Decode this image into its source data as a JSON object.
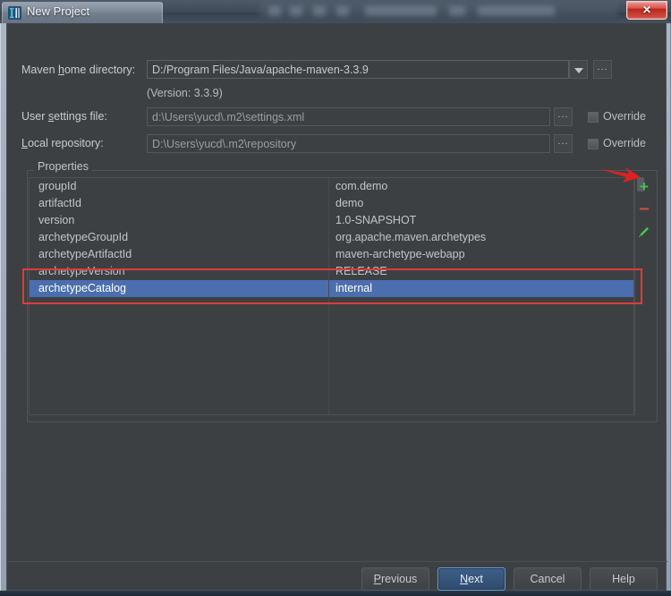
{
  "window": {
    "title": "New Project",
    "icon": "intellij-idea-icon",
    "close_label": "✕"
  },
  "form": {
    "maven_home": {
      "label_pre": "Maven ",
      "label_accel": "h",
      "label_post": "ome directory:",
      "label_full": "Maven home directory:",
      "value": "D:/Program Files/Java/apache-maven-3.3.9",
      "dropdown_icon": "chevron-down-icon",
      "browse_label": "..."
    },
    "version_note": "(Version: 3.3.9)",
    "user_settings": {
      "label_full": "User settings file:",
      "value": "d:\\Users\\yucd\\.m2\\settings.xml",
      "browse_label": "...",
      "override_label": "Override",
      "override_checked": false
    },
    "local_repository": {
      "label_full": "Local repository:",
      "value": "D:\\Users\\yucd\\.m2\\repository",
      "browse_label": "...",
      "override_label": "Override",
      "override_checked": false
    }
  },
  "properties": {
    "group_title": "Properties",
    "rows": [
      {
        "key": "groupId",
        "value": "com.demo",
        "selected": false
      },
      {
        "key": "artifactId",
        "value": "demo",
        "selected": false
      },
      {
        "key": "version",
        "value": "1.0-SNAPSHOT",
        "selected": false
      },
      {
        "key": "archetypeGroupId",
        "value": "org.apache.maven.archetypes",
        "selected": false
      },
      {
        "key": "archetypeArtifactId",
        "value": "maven-archetype-webapp",
        "selected": false
      },
      {
        "key": "archetypeVersion",
        "value": "RELEASE",
        "selected": false
      },
      {
        "key": "archetypeCatalog",
        "value": "internal",
        "selected": true
      }
    ],
    "toolbar": {
      "add_label": "+",
      "remove_label": "−",
      "edit_icon": "pencil-icon"
    }
  },
  "annotations": {
    "arrow_icon": "red-arrow-icon",
    "highlight_icon": "red-rectangle-highlight"
  },
  "footer": {
    "previous": {
      "pre": "",
      "accel": "P",
      "post": "revious",
      "full": "Previous"
    },
    "next": {
      "pre": "",
      "accel": "N",
      "post": "ext",
      "full": "Next"
    },
    "cancel": {
      "full": "Cancel"
    },
    "help": {
      "full": "Help"
    }
  },
  "colors": {
    "dialog_bg": "#3c4043",
    "selection_blue": "#4b6eaf",
    "annotation_red": "#e03b3b",
    "add_green": "#49c04b",
    "remove_red": "#c8503c",
    "close_red": "#b9251c"
  }
}
